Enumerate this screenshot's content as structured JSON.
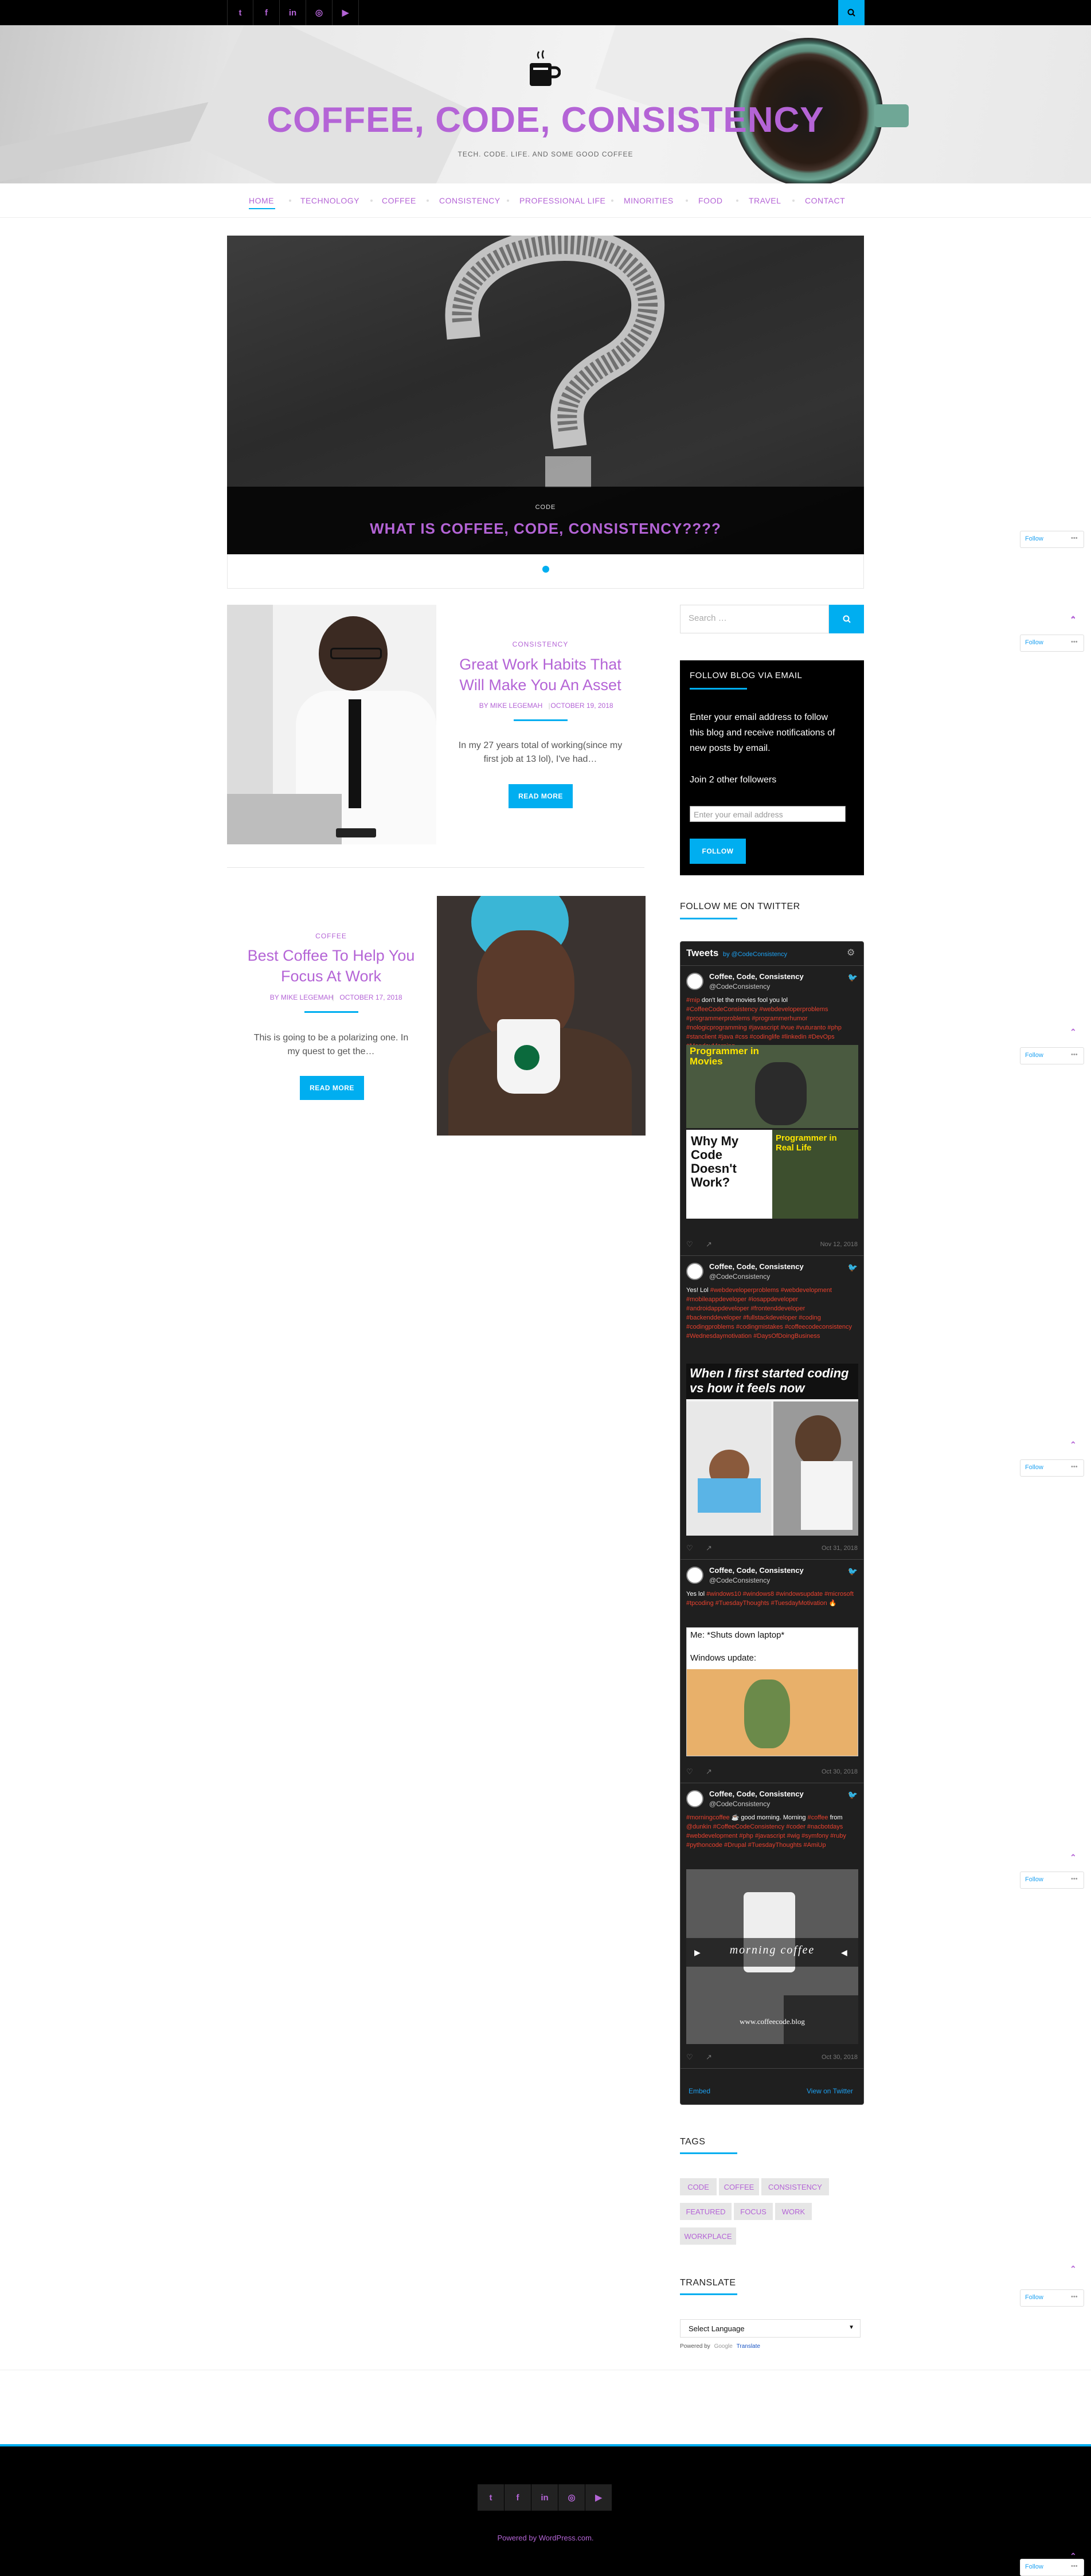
{
  "top_bar": {
    "social_icons": [
      "twitter-icon",
      "facebook-icon",
      "linkedin-icon",
      "instagram-icon",
      "youtube-icon"
    ],
    "social_glyphs": [
      "t",
      "f",
      "in",
      "◎",
      "▶"
    ]
  },
  "header": {
    "site_title": "COFFEE, CODE, CONSISTENCY",
    "tagline": "TECH. CODE. LIFE. AND SOME GOOD COFFEE"
  },
  "nav": {
    "items": [
      "HOME",
      "TECHNOLOGY",
      "COFFEE",
      "CONSISTENCY",
      "PROFESSIONAL LIFE",
      "MINORITIES",
      "FOOD",
      "TRAVEL",
      "CONTACT"
    ],
    "active": "HOME"
  },
  "slider": {
    "category": "CODE",
    "title": "WHAT IS COFFEE, CODE, CONSISTENCY????"
  },
  "posts": [
    {
      "category": "CONSISTENCY",
      "title_line1": "Great Work Habits That",
      "title_line2": "Will Make You An Asset",
      "author": "BY MIKE LEGEMAH",
      "date": "OCTOBER 19, 2018",
      "excerpt_line1": "In my 27 years total of working(since my",
      "excerpt_line2": "first job at 13 lol), I've had…",
      "button": "READ MORE"
    },
    {
      "category": "COFFEE",
      "title_line1": "Best Coffee To Help You",
      "title_line2": "Focus At Work",
      "author": "BY MIKE LEGEMAH",
      "date": "OCTOBER 17, 2018",
      "excerpt_line1": "This is going to be a polarizing one. In",
      "excerpt_line2": "my quest to get the…",
      "button": "READ MORE"
    }
  ],
  "sidebar": {
    "search_placeholder": "Search …",
    "follow_widget": {
      "title": "FOLLOW BLOG VIA EMAIL",
      "text_line1": "Enter your email address to follow",
      "text_line2": "this blog and receive notifications of",
      "text_line3": "new posts by email.",
      "followers": "Join 2 other followers",
      "email_placeholder": "Enter your email address",
      "button": "FOLLOW"
    },
    "twitter": {
      "section_title": "FOLLOW ME ON TWITTER",
      "header_title": "Tweets",
      "header_by": "by @CodeConsistency",
      "account_name": "Coffee, Code, Consistency",
      "account_handle": "@CodeConsistency",
      "tweets": [
        {
          "date": "Nov 12, 2018",
          "image_text_a": "Programmer in Movies",
          "image_text_b": "Why My Code Doesn't Work?",
          "image_text_c": "Programmer in Real Life"
        },
        {
          "date": "Oct 31, 2018",
          "image_text_a": "When I first started coding vs how it feels now"
        },
        {
          "date": "Oct 30, 2018",
          "image_text_a": "Me: *Shuts down laptop*",
          "image_text_b": "Windows update:"
        },
        {
          "date": "Oct 30, 2018",
          "image_text_a": "morning coffee",
          "image_text_b": "www.coffeecode.blog"
        }
      ],
      "footer_embed": "Embed",
      "footer_view": "View on Twitter"
    },
    "tags": {
      "title": "TAGS",
      "items": [
        "CODE",
        "COFFEE",
        "CONSISTENCY",
        "FEATURED",
        "FOCUS",
        "WORK",
        "WORKPLACE"
      ]
    },
    "translate": {
      "title": "TRANSLATE",
      "select_value": "Select Language",
      "powered_by": "Powered by",
      "google": "Google",
      "translate_link": "Translate"
    }
  },
  "floaters": {
    "follow_label": "Follow",
    "more_label": "•••"
  },
  "footer": {
    "social_glyphs": [
      "t",
      "f",
      "in",
      "◎",
      "▶"
    ],
    "credit": "Powered by WordPress.com."
  },
  "colors": {
    "accent": "#00aef0",
    "brand": "#b464d6",
    "hashtag": "#e8412e"
  }
}
